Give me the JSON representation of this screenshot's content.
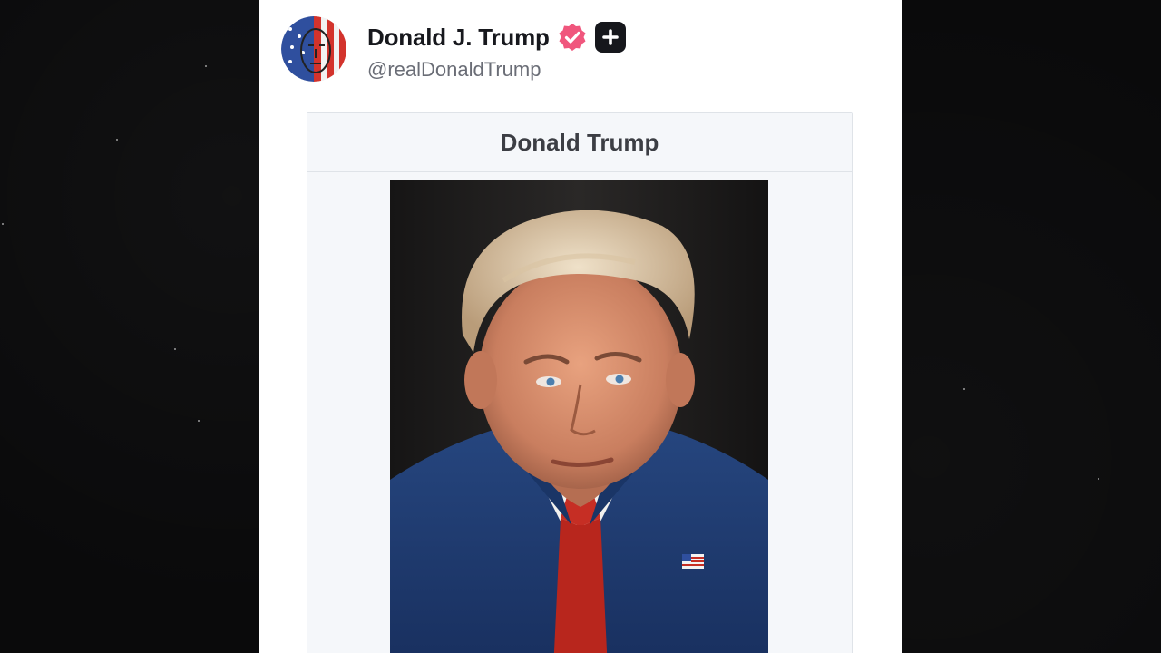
{
  "post": {
    "author": {
      "display_name": "Donald J. Trump",
      "handle": "@realDonaldTrump",
      "avatar": "flag-face-avatar",
      "verified_icon": "verified-badge-icon",
      "plus_icon": "plus-badge-icon"
    },
    "card": {
      "title": "Donald Trump",
      "image": "portrait-photo"
    }
  },
  "colors": {
    "background": "#0a0a0b",
    "post_bg": "#ffffff",
    "card_bg": "#f5f7fa",
    "verified": "#f0567d",
    "name_text": "#17181d",
    "handle_text": "#6a6d76",
    "title_text": "#3c3e44",
    "suit": "#1f3d7a",
    "tie": "#c62e24"
  }
}
